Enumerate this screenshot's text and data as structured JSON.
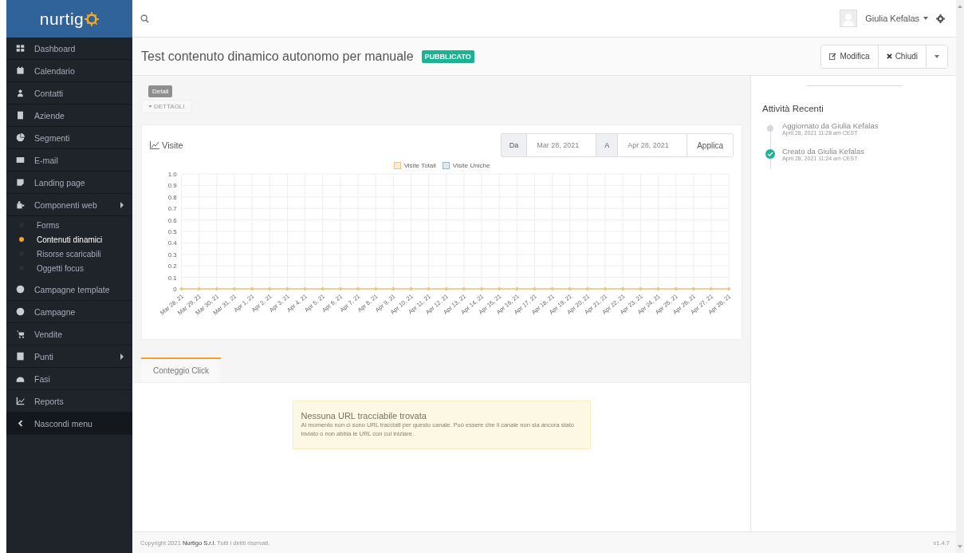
{
  "sidebar": {
    "logo": "nurtig",
    "items": [
      {
        "label": "Dashboard",
        "selected": false,
        "submenu": false
      },
      {
        "label": "Calendario",
        "selected": false,
        "submenu": false
      },
      {
        "label": "Contatti",
        "selected": false,
        "submenu": false
      },
      {
        "label": "Aziende",
        "selected": false,
        "submenu": false
      },
      {
        "label": "Segmenti",
        "selected": false,
        "submenu": false
      },
      {
        "label": "E-mail",
        "selected": false,
        "submenu": false
      },
      {
        "label": "Landing page",
        "selected": false,
        "submenu": false
      },
      {
        "label": "Componenti web",
        "selected": false,
        "submenu": true,
        "children": [
          {
            "label": "Forms",
            "selected": false
          },
          {
            "label": "Contenuti dinamici",
            "selected": true
          },
          {
            "label": "Risorse scaricabili",
            "selected": false
          },
          {
            "label": "Oggetti focus",
            "selected": false
          }
        ]
      },
      {
        "label": "Campagne template",
        "selected": false,
        "submenu": false
      },
      {
        "label": "Campagne",
        "selected": false,
        "submenu": false
      },
      {
        "label": "Vendite",
        "selected": false,
        "submenu": false
      },
      {
        "label": "Punti",
        "selected": false,
        "submenu": true
      },
      {
        "label": "Fasi",
        "selected": false,
        "submenu": false
      },
      {
        "label": "Reports",
        "selected": false,
        "submenu": false
      },
      {
        "label": "Nascondi menu",
        "selected": false,
        "submenu": false
      }
    ]
  },
  "topbar": {
    "user": "Giulia Kefalas"
  },
  "header": {
    "title": "Test contenuto dinamico autonomo per manuale",
    "badge": "PUBBLICATO",
    "buttons": [
      "Modifica",
      "Chiudi"
    ]
  },
  "details": {
    "tooltip": "Detail",
    "button": "DETTAGLI"
  },
  "visits": {
    "title": "Visite",
    "from_label": "Da",
    "from": "Mar 28, 2021",
    "to_label": "A",
    "to": "Apr 28, 2021",
    "apply": "Applica",
    "chart_data": {
      "type": "line",
      "categories": [
        "Mar 28, 21",
        "Mar 29, 21",
        "Mar 30, 21",
        "Mar 31, 21",
        "Apr 1, 21",
        "Apr 2, 21",
        "Apr 3, 21",
        "Apr 4, 21",
        "Apr 5, 21",
        "Apr 6, 21",
        "Apr 7, 21",
        "Apr 8, 21",
        "Apr 9, 21",
        "Apr 10, 21",
        "Apr 11, 21",
        "Apr 12, 21",
        "Apr 13, 21",
        "Apr 14, 21",
        "Apr 15, 21",
        "Apr 16, 21",
        "Apr 17, 21",
        "Apr 18, 21",
        "Apr 19, 21",
        "Apr 20, 21",
        "Apr 21, 21",
        "Apr 22, 21",
        "Apr 23, 21",
        "Apr 24, 21",
        "Apr 25, 21",
        "Apr 26, 21",
        "Apr 27, 21",
        "Apr 28, 21"
      ],
      "series": [
        {
          "name": "Visite Totali",
          "color": "#f0c27a",
          "values": [
            0,
            0,
            0,
            0,
            0,
            0,
            0,
            0,
            0,
            0,
            0,
            0,
            0,
            0,
            0,
            0,
            0,
            0,
            0,
            0,
            0,
            0,
            0,
            0,
            0,
            0,
            0,
            0,
            0,
            0,
            0,
            0
          ]
        },
        {
          "name": "Visite Uniche",
          "color": "#8cb8e0",
          "values": [
            null,
            null,
            null,
            null,
            null,
            null,
            null,
            null,
            null,
            null,
            null,
            null,
            null,
            null,
            null,
            null,
            null,
            null,
            null,
            null,
            null,
            null,
            null,
            null,
            null,
            null,
            null,
            null,
            null,
            null,
            null,
            null
          ]
        }
      ],
      "grid": true,
      "ylim": [
        0,
        1
      ],
      "yticks": [
        0,
        0.1,
        0.2,
        0.3,
        0.4,
        0.5,
        0.6,
        0.7,
        0.8,
        0.9,
        {
          "value": 1,
          "label": "1.0"
        }
      ]
    }
  },
  "tabs": [
    {
      "label": "Conteggio Click",
      "selected": true
    }
  ],
  "alert": {
    "title": "Nessuna URL tracciabile trovata",
    "text": "Al momento non ci sono URL tracciati per questo canale. Può essere che il canale non sia ancora stato inviato o non abbia le URL con cui iniziare."
  },
  "activity": {
    "title": "Attività Recenti",
    "items": [
      {
        "text": "Aggiornato da Giulia Kefalas",
        "time": "April 28, 2021 11:28 am CEST",
        "kind": "update"
      },
      {
        "text": "Creato da Giulia Kefalas",
        "time": "April 28, 2021 11:24 am CEST",
        "kind": "create"
      }
    ]
  },
  "footer": {
    "copyright": "Copyright 2021 **Nurtigo S.r.l.** Tutti i diritti riservati.",
    "version": "v1.4.7"
  }
}
